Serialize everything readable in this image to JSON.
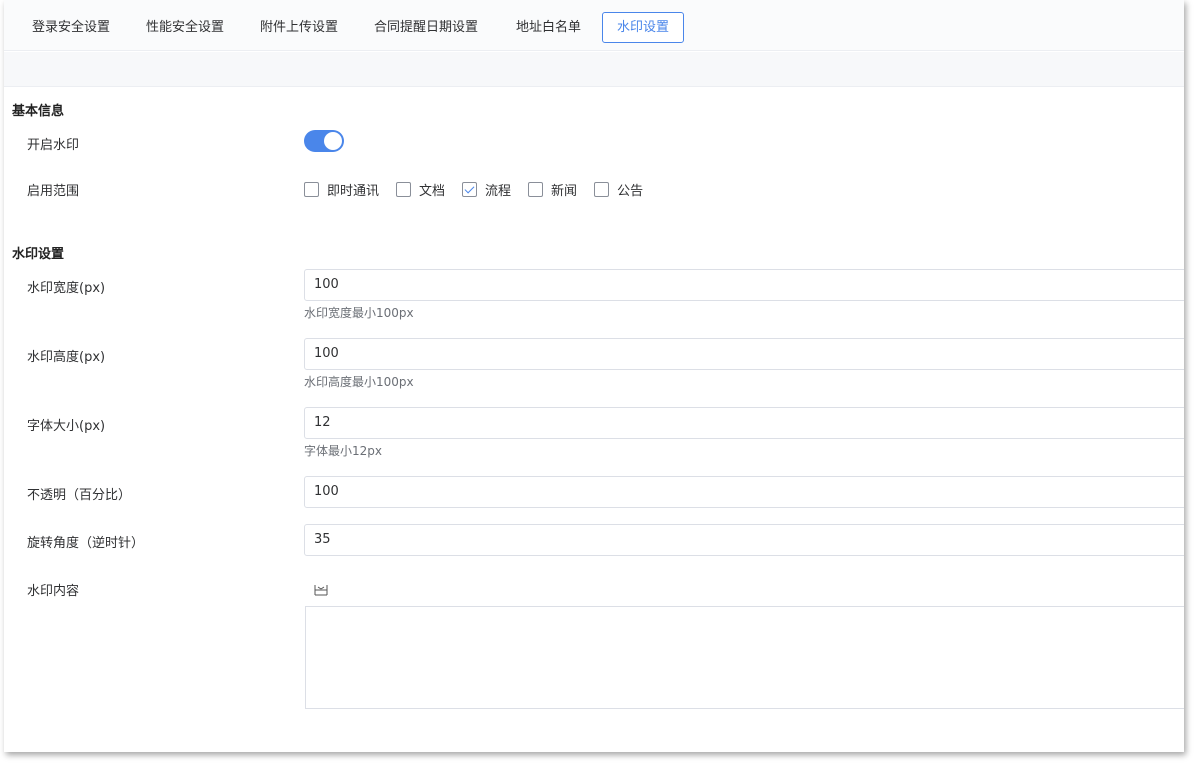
{
  "tabs": [
    {
      "label": "登录安全设置",
      "active": false
    },
    {
      "label": "性能安全设置",
      "active": false
    },
    {
      "label": "附件上传设置",
      "active": false
    },
    {
      "label": "合同提醒日期设置",
      "active": false
    },
    {
      "label": "地址白名单",
      "active": false
    },
    {
      "label": "水印设置",
      "active": true
    }
  ],
  "basic": {
    "title": "基本信息",
    "enable_label": "开启水印",
    "enable_value": true,
    "scope_label": "启用范围",
    "scope_options": [
      {
        "label": "即时通讯",
        "checked": false
      },
      {
        "label": "文档",
        "checked": false
      },
      {
        "label": "流程",
        "checked": true
      },
      {
        "label": "新闻",
        "checked": false
      },
      {
        "label": "公告",
        "checked": false
      }
    ]
  },
  "watermark": {
    "title": "水印设置",
    "width": {
      "label": "水印宽度(px)",
      "value": "100",
      "hint": "水印宽度最小100px"
    },
    "height": {
      "label": "水印高度(px)",
      "value": "100",
      "hint": "水印高度最小100px"
    },
    "font_size": {
      "label": "字体大小(px)",
      "value": "12",
      "hint": "字体最小12px"
    },
    "opacity": {
      "label": "不透明（百分比）",
      "value": "100"
    },
    "rotation": {
      "label": "旋转角度（逆时针）",
      "value": "35"
    },
    "content": {
      "label": "水印内容",
      "toolbar_icon": "insert-row-icon",
      "value": ""
    }
  },
  "colors": {
    "accent": "#4a86ea",
    "border": "#dcdfe6",
    "hint": "#6b6f76"
  }
}
